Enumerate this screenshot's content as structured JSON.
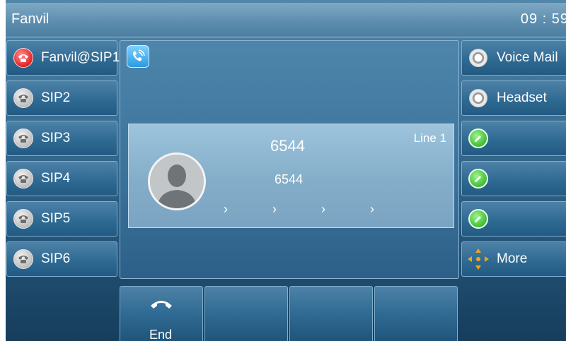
{
  "header": {
    "title": "Fanvil",
    "clock": "09 : 59"
  },
  "lines": [
    {
      "label": "Fanvil@SIP1",
      "icon": "red-handset-icon",
      "active": true
    },
    {
      "label": "SIP2",
      "icon": "gray-handset-icon",
      "active": false
    },
    {
      "label": "SIP3",
      "icon": "gray-handset-icon",
      "active": false
    },
    {
      "label": "SIP4",
      "icon": "gray-handset-icon",
      "active": false
    },
    {
      "label": "SIP5",
      "icon": "gray-handset-icon",
      "active": false
    },
    {
      "label": "SIP6",
      "icon": "gray-handset-icon",
      "active": false
    }
  ],
  "dsskeys": [
    {
      "label": "Voice Mail",
      "icon": "radio-icon"
    },
    {
      "label": "Headset",
      "icon": "radio-icon"
    },
    {
      "label": "",
      "icon": "pencil-icon"
    },
    {
      "label": "",
      "icon": "pencil-icon"
    },
    {
      "label": "",
      "icon": "pencil-icon"
    },
    {
      "label": "More",
      "icon": "arrows-icon"
    }
  ],
  "call": {
    "name": "6544",
    "number": "6544",
    "line": "Line 1",
    "progress": "› › › ›"
  },
  "softkeys": [
    {
      "label": "End",
      "icon": "end-call-icon"
    },
    {
      "label": ""
    },
    {
      "label": ""
    },
    {
      "label": ""
    }
  ],
  "colors": {
    "background": "#2f6a93",
    "active_line": "#e52b2b",
    "pencil": "#3fbe36",
    "arrows": "#f2a51c"
  }
}
